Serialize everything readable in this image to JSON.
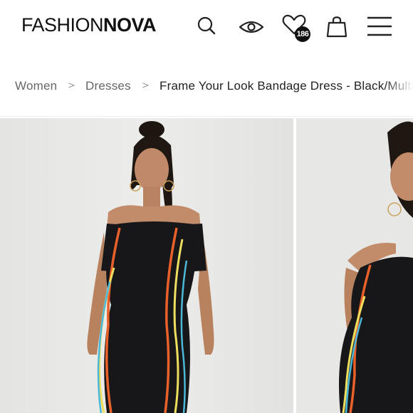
{
  "header": {
    "logo_light": "FASHION",
    "logo_bold": "NOVA",
    "wishlist_count": "186",
    "icons": {
      "search": "search-icon",
      "recently_viewed": "eye-icon",
      "wishlist": "heart-icon",
      "bag": "shopping-bag-icon",
      "menu": "hamburger-menu-icon"
    }
  },
  "breadcrumb": {
    "items": [
      "Women",
      "Dresses",
      "Frame Your Look Bandage Dress - Black/Multi"
    ],
    "separator": ">"
  },
  "gallery": {
    "images": [
      "product-photo-front",
      "product-photo-side"
    ]
  },
  "colors": {
    "dress": "#17171a",
    "stripe_orange": "#e8602a",
    "stripe_yellow": "#eedf5f",
    "stripe_blue": "#4cb8d8",
    "photo_bg": "#e7e7e5"
  }
}
